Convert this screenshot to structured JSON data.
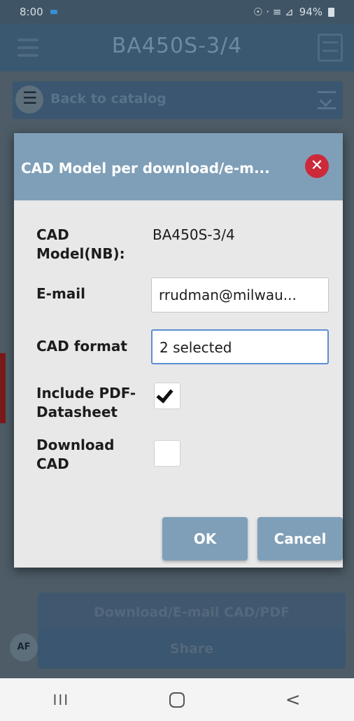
{
  "status_bar": {
    "time": "8:00",
    "indicators": "☉ · ≡ ⊿",
    "battery": "94%"
  },
  "app_header": {
    "title": "BA450S-3/4"
  },
  "back_bar": {
    "label": "Back to catalog"
  },
  "dialog": {
    "title": "CAD Model per download/e-m...",
    "fields": {
      "cad_model_label": "CAD Model(NB):",
      "cad_model_value": "BA450S-3/4",
      "email_label": "E-mail",
      "email_value": "rrudman@milwau...",
      "cad_format_label": "CAD format",
      "cad_format_value": "2 selected",
      "include_pdf_label": "Include PDF-Datasheet",
      "include_pdf_checked": true,
      "download_cad_label": "Download CAD",
      "download_cad_checked": false
    },
    "ok_label": "OK",
    "cancel_label": "Cancel"
  },
  "background_actions": {
    "download_label": "Download/E-mail CAD/PDF",
    "share_label": "Share",
    "pdf_icon_text": "AF"
  },
  "nav_bar": {
    "recent_glyph": "III",
    "back_glyph": "<"
  },
  "colors": {
    "dialog_header": "#7f9fb8",
    "close_icon": "#cc2a3a",
    "focus_border": "#5c8fd0"
  }
}
